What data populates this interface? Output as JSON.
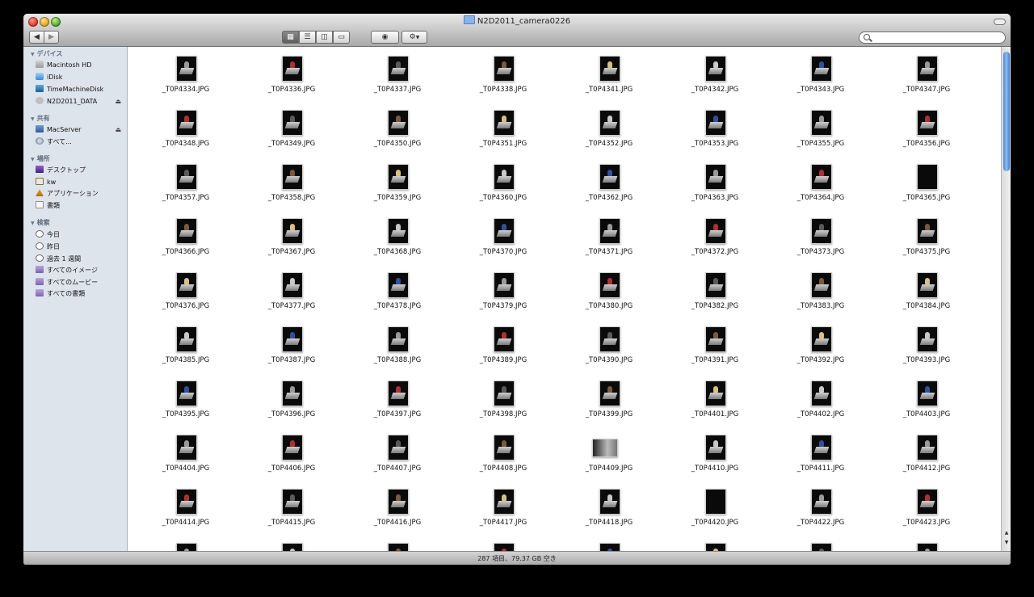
{
  "window": {
    "title": "N2D2011_camera0226"
  },
  "toolbar": {
    "back_icon": "back-arrow-icon",
    "forward_icon": "forward-arrow-icon",
    "views": [
      "icon-view",
      "list-view",
      "column-view",
      "coverflow-view"
    ],
    "active_view": "icon-view",
    "search_placeholder": ""
  },
  "sidebar": {
    "devices_header": "デバイス",
    "devices": [
      {
        "label": "Macintosh HD",
        "icon": "hard-drive-icon"
      },
      {
        "label": "iDisk",
        "icon": "idisk-icon"
      },
      {
        "label": "TimeMachineDisk",
        "icon": "time-machine-icon"
      },
      {
        "label": "N2D2011_DATA",
        "icon": "usb-drive-icon"
      }
    ],
    "shared_header": "共有",
    "shared": [
      {
        "label": "MacServer",
        "icon": "server-icon"
      },
      {
        "label": "すべて...",
        "icon": "network-icon"
      }
    ],
    "places_header": "場所",
    "places": [
      {
        "label": "デスクトップ",
        "icon": "desktop-icon"
      },
      {
        "label": "kw",
        "icon": "home-icon"
      },
      {
        "label": "アプリケーション",
        "icon": "applications-icon"
      },
      {
        "label": "書類",
        "icon": "documents-icon"
      }
    ],
    "search_header": "検索",
    "search": [
      {
        "label": "今日",
        "icon": "clock-icon"
      },
      {
        "label": "昨日",
        "icon": "clock-icon"
      },
      {
        "label": "過去 1 週間",
        "icon": "clock-icon"
      },
      {
        "label": "すべてのイメージ",
        "icon": "smart-folder-icon"
      },
      {
        "label": "すべてのムービー",
        "icon": "smart-folder-icon"
      },
      {
        "label": "すべての書類",
        "icon": "smart-folder-icon"
      }
    ]
  },
  "files": [
    "_T0P4334.JPG",
    "_T0P4336.JPG",
    "_T0P4337.JPG",
    "_T0P4338.JPG",
    "_T0P4341.JPG",
    "_T0P4342.JPG",
    "_T0P4343.JPG",
    "_T0P4347.JPG",
    "_T0P4348.JPG",
    "_T0P4349.JPG",
    "_T0P4350.JPG",
    "_T0P4351.JPG",
    "_T0P4352.JPG",
    "_T0P4353.JPG",
    "_T0P4355.JPG",
    "_T0P4356.JPG",
    "_T0P4357.JPG",
    "_T0P4358.JPG",
    "_T0P4359.JPG",
    "_T0P4360.JPG",
    "_T0P4362.JPG",
    "_T0P4363.JPG",
    "_T0P4364.JPG",
    "_T0P4365.JPG",
    "_T0P4366.JPG",
    "_T0P4367.JPG",
    "_T0P4368.JPG",
    "_T0P4370.JPG",
    "_T0P4371.JPG",
    "_T0P4372.JPG",
    "_T0P4373.JPG",
    "_T0P4375.JPG",
    "_T0P4376.JPG",
    "_T0P4377.JPG",
    "_T0P4378.JPG",
    "_T0P4379.JPG",
    "_T0P4380.JPG",
    "_T0P4382.JPG",
    "_T0P4383.JPG",
    "_T0P4384.JPG",
    "_T0P4385.JPG",
    "_T0P4387.JPG",
    "_T0P4388.JPG",
    "_T0P4389.JPG",
    "_T0P4390.JPG",
    "_T0P4391.JPG",
    "_T0P4392.JPG",
    "_T0P4393.JPG",
    "_T0P4395.JPG",
    "_T0P4396.JPG",
    "_T0P4397.JPG",
    "_T0P4398.JPG",
    "_T0P4399.JPG",
    "_T0P4401.JPG",
    "_T0P4402.JPG",
    "_T0P4403.JPG",
    "_T0P4404.JPG",
    "_T0P4406.JPG",
    "_T0P4407.JPG",
    "_T0P4408.JPG",
    "_T0P4409.JPG",
    "_T0P4410.JPG",
    "_T0P4411.JPG",
    "_T0P4412.JPG",
    "_T0P4414.JPG",
    "_T0P4415.JPG",
    "_T0P4416.JPG",
    "_T0P4417.JPG",
    "_T0P4418.JPG",
    "_T0P4420.JPG",
    "_T0P4422.JPG",
    "_T0P4423.JPG"
  ],
  "status": {
    "text": "287 項目、79.37 GB 空き"
  }
}
